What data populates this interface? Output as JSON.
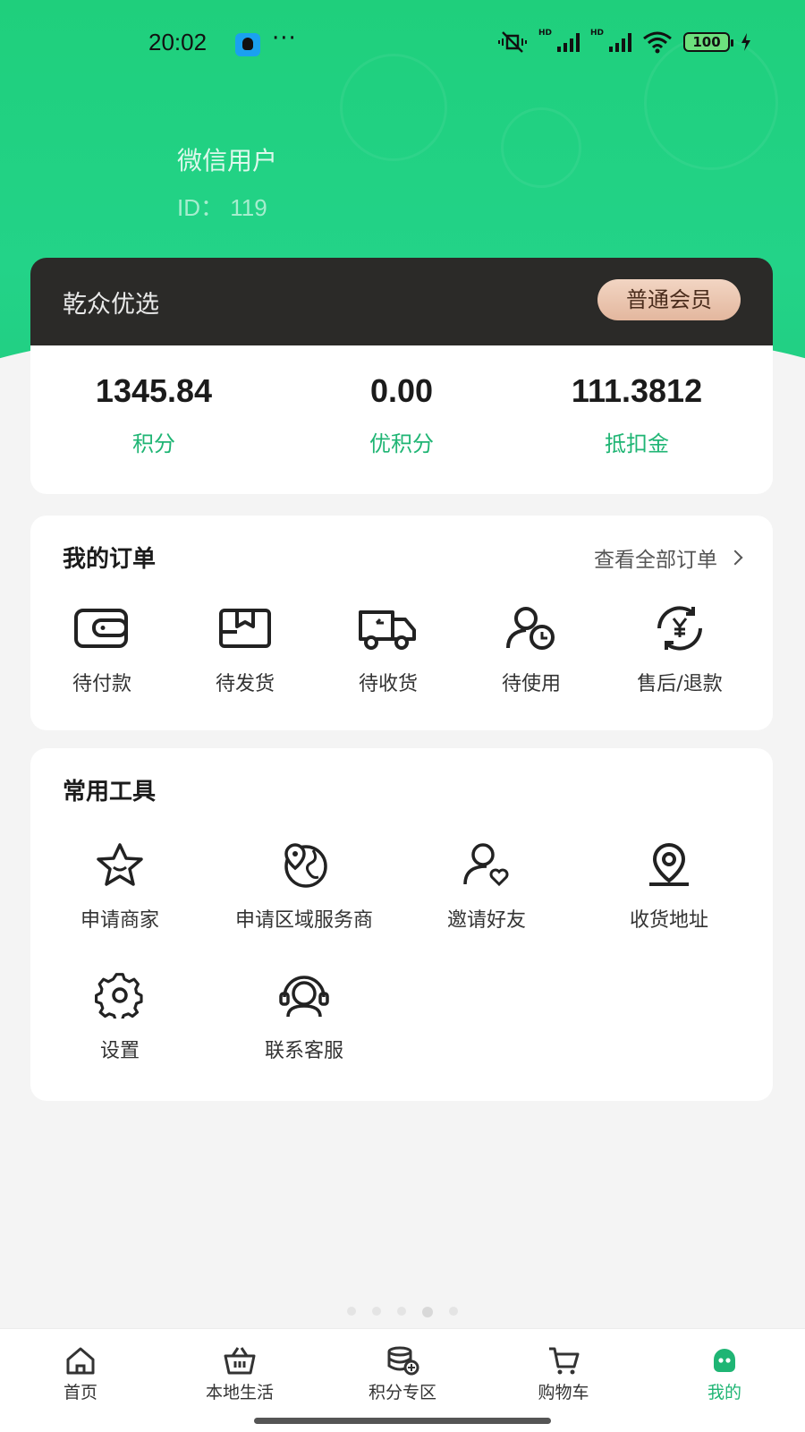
{
  "status_bar": {
    "time": "20:02",
    "dots": "···",
    "battery": "100"
  },
  "user": {
    "name": "微信用户",
    "id_text": "ID： 119"
  },
  "member": {
    "store_name": "乾众优选",
    "level": "普通会员"
  },
  "stats": [
    {
      "value": "1345.84",
      "label": "积分"
    },
    {
      "value": "0.00",
      "label": "优积分"
    },
    {
      "value": "111.3812",
      "label": "抵扣金"
    }
  ],
  "orders": {
    "title": "我的订单",
    "view_all": "查看全部订单",
    "items": [
      {
        "label": "待付款",
        "icon": "wallet-icon"
      },
      {
        "label": "待发货",
        "icon": "package-icon"
      },
      {
        "label": "待收货",
        "icon": "truck-icon"
      },
      {
        "label": "待使用",
        "icon": "user-clock-icon"
      },
      {
        "label": "售后/退款",
        "icon": "refund-icon"
      }
    ]
  },
  "tools": {
    "title": "常用工具",
    "items": [
      {
        "label": "申请商家",
        "icon": "star-icon"
      },
      {
        "label": "申请区域服务商",
        "icon": "map-pin-globe-icon"
      },
      {
        "label": "邀请好友",
        "icon": "user-heart-icon"
      },
      {
        "label": "收货地址",
        "icon": "location-icon"
      },
      {
        "label": "设置",
        "icon": "gear-icon"
      },
      {
        "label": "联系客服",
        "icon": "headset-icon"
      }
    ]
  },
  "tabbar": {
    "items": [
      {
        "label": "首页",
        "icon": "home-icon"
      },
      {
        "label": "本地生活",
        "icon": "basket-icon"
      },
      {
        "label": "积分专区",
        "icon": "coins-icon"
      },
      {
        "label": "购物车",
        "icon": "cart-icon"
      },
      {
        "label": "我的",
        "icon": "profile-icon",
        "active": true
      }
    ],
    "active_color": "#1fb574"
  },
  "colors": {
    "brand_green": "#22cf83",
    "accent_text_green": "#1fb574",
    "member_card_dark": "#2b2a28",
    "badge_gold": "#e3b79e"
  }
}
